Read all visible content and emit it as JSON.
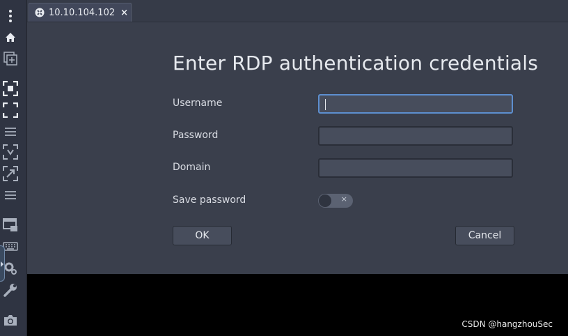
{
  "tab": {
    "title": "10.10.104.102",
    "close_glyph": "×",
    "icon": "connection-icon"
  },
  "sidebar": {
    "items": [
      {
        "icon": "menu-dots-icon"
      },
      {
        "icon": "home-icon"
      },
      {
        "icon": "new-tab-icon"
      },
      {
        "icon": "fit-window-icon"
      },
      {
        "icon": "fullscreen-icon"
      },
      {
        "icon": "separator-lines-icon"
      },
      {
        "icon": "scaled-mode-icon"
      },
      {
        "icon": "fit-screen-icon"
      },
      {
        "icon": "separator-lines-icon"
      },
      {
        "icon": "multi-monitor-icon"
      },
      {
        "icon": "keyboard-icon"
      },
      {
        "icon": "preferences-icon"
      },
      {
        "icon": "tools-icon"
      },
      {
        "icon": "screenshot-icon"
      }
    ]
  },
  "dialog": {
    "title": "Enter RDP authentication credentials",
    "username_label": "Username",
    "username_value": "",
    "password_label": "Password",
    "password_value": "",
    "domain_label": "Domain",
    "domain_value": "",
    "save_password_label": "Save password",
    "save_password_on": false,
    "toggle_off_glyph": "×",
    "ok_label": "OK",
    "cancel_label": "Cancel"
  },
  "watermark": "CSDN @hangzhouSec",
  "colors": {
    "background": "#3a3f4c",
    "sidebar": "#2f3442",
    "field_focus": "#5d8fd0"
  }
}
